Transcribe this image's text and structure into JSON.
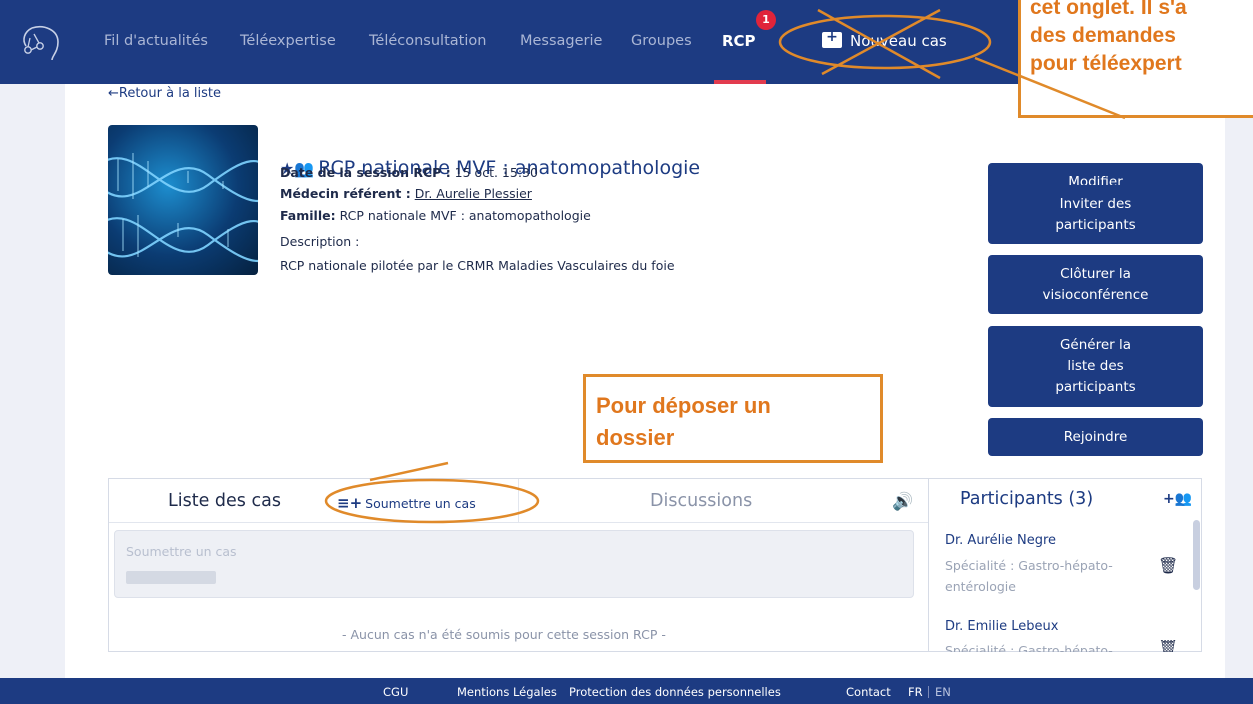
{
  "nav": {
    "items": [
      "Fil d'actualités",
      "Téléexpertise",
      "Téléconsultation",
      "Messagerie",
      "Groupes"
    ],
    "active": "RCP",
    "badge": "1",
    "new_case": "Nouveau cas"
  },
  "back_link": "←Retour à la liste",
  "rcp": {
    "title": "RCP nationale MVF : anatomopathologie",
    "date_label": "Date de la session RCP :",
    "date_value": " 15 oct. 15:30",
    "doctor_label": "Médecin référent :",
    "doctor_value": "Dr. Aurelie Plessier",
    "family_label": "Famille:",
    "family_value": " RCP nationale MVF : anatomopathologie",
    "description_label": "Description :",
    "description_value": "RCP nationale pilotée par le CRMR Maladies Vasculaires du foie"
  },
  "actions": {
    "modify": "Modifier",
    "invite_1": "Inviter des",
    "invite_2": "participants",
    "close_1": "Clôturer la",
    "close_2": "visioconférence",
    "generate_1": "Générer la",
    "generate_2": "liste des",
    "generate_3": "participants",
    "join": "Rejoindre"
  },
  "cases": {
    "tab_label": "Liste des cas",
    "submit_label": "Soumettre un cas",
    "discussions_label": "Discussions",
    "submit_box_label": "Soumettre un cas",
    "empty_message": "- Aucun cas n'a été soumis pour cette session RCP -"
  },
  "participants": {
    "title": "Participants (3)",
    "list": [
      {
        "name": "Dr. Aurélie Negre",
        "spec_1": "Spécialité : Gastro-hépato-",
        "spec_2": "entérologie"
      },
      {
        "name": "Dr. Emilie Lebeux",
        "spec_1": "Spécialité : Gastro-hépato-",
        "spec_2": ""
      }
    ]
  },
  "footer": {
    "links": [
      "CGU",
      "Mentions Légales",
      "Protection des données personnelles",
      "Contact"
    ],
    "lang_fr": "FR",
    "lang_en": "EN"
  },
  "annotations": {
    "top_lines": [
      "cet onglet. Il s'a",
      "des demandes",
      "pour téléexpert"
    ],
    "mid_lines": [
      "Pour déposer un",
      "dossier"
    ],
    "accent_color": "#e08a2a"
  },
  "colors": {
    "brand_navy": "#1d3b82",
    "badge_red": "#e0243a"
  }
}
